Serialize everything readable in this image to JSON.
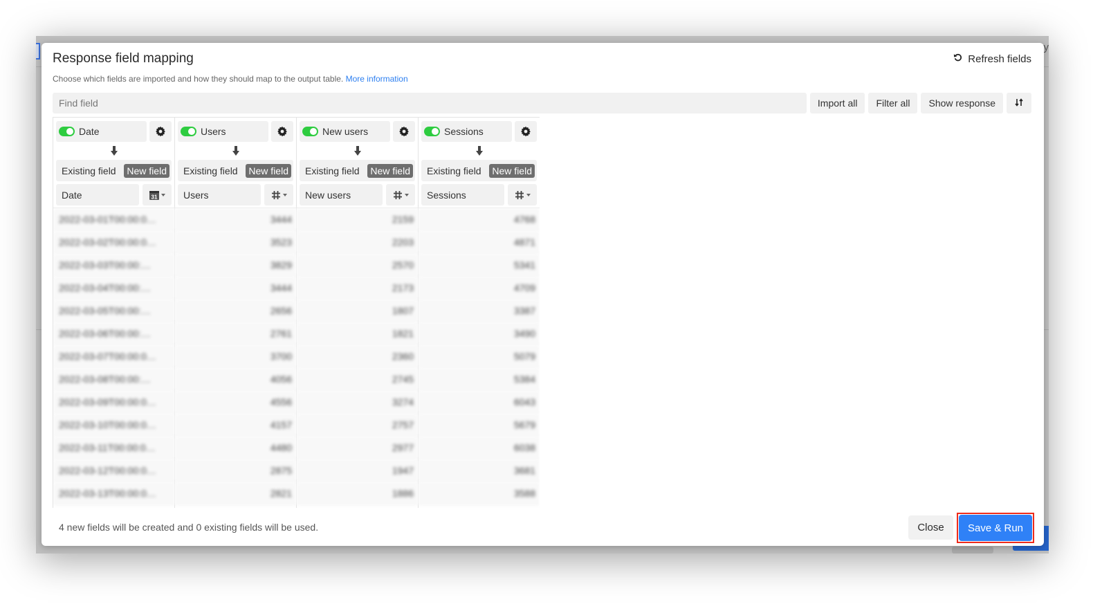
{
  "modal": {
    "title": "Response field mapping",
    "subtitle": "Choose which fields are imported and how they should map to the output table.",
    "more_info_link": "More information",
    "refresh_label": "Refresh fields"
  },
  "toolbar": {
    "search_placeholder": "Find field",
    "search_value": "",
    "import_all": "Import all",
    "filter_all": "Filter all",
    "show_response": "Show response",
    "sort_icon": "sort-icon"
  },
  "columns": [
    {
      "field": "Date",
      "enabled": true,
      "mode_existing": "Existing field",
      "mode_new": "New field",
      "selected_mode": "New field",
      "destination": "Date",
      "type_icon": "calendar-icon",
      "type_icon_text": "31",
      "values": [
        "2022-03-01T00:00:0…",
        "2022-03-02T00:00:0…",
        "2022-03-03T00:00:…",
        "2022-03-04T00:00:…",
        "2022-03-05T00:00:…",
        "2022-03-06T00:00:…",
        "2022-03-07T00:00:0…",
        "2022-03-08T00:00:…",
        "2022-03-09T00:00:0…",
        "2022-03-10T00:00:0…",
        "2022-03-11T00:00:0…",
        "2022-03-12T00:00:0…",
        "2022-03-13T00:00:0…"
      ]
    },
    {
      "field": "Users",
      "enabled": true,
      "mode_existing": "Existing field",
      "mode_new": "New field",
      "selected_mode": "New field",
      "destination": "Users",
      "type_icon": "number-icon",
      "values": [
        "3444",
        "3523",
        "3829",
        "3444",
        "2656",
        "2761",
        "3700",
        "4056",
        "4556",
        "4157",
        "4480",
        "2875",
        "2821"
      ]
    },
    {
      "field": "New users",
      "enabled": true,
      "mode_existing": "Existing field",
      "mode_new": "New field",
      "selected_mode": "New field",
      "destination": "New users",
      "type_icon": "number-icon",
      "values": [
        "2159",
        "2203",
        "2570",
        "2173",
        "1807",
        "1821",
        "2360",
        "2745",
        "3274",
        "2757",
        "2977",
        "1947",
        "1886"
      ]
    },
    {
      "field": "Sessions",
      "enabled": true,
      "mode_existing": "Existing field",
      "mode_new": "New field",
      "selected_mode": "New field",
      "destination": "Sessions",
      "type_icon": "number-icon",
      "values": [
        "4768",
        "4871",
        "5341",
        "4709",
        "3387",
        "3490",
        "5079",
        "5384",
        "6043",
        "5679",
        "6038",
        "3681",
        "3588"
      ]
    }
  ],
  "footer": {
    "summary": "4 new fields will be created and 0 existing fields will be used.",
    "close_label": "Close",
    "save_label": "Save & Run"
  },
  "background": {
    "partial_text": "y"
  },
  "colors": {
    "accent": "#2f81f7",
    "link": "#2d7ff0",
    "toggle_on": "#2ecc40",
    "new_field_selected": "#6e6e6e",
    "highlight_outline": "#ee2a1a"
  }
}
